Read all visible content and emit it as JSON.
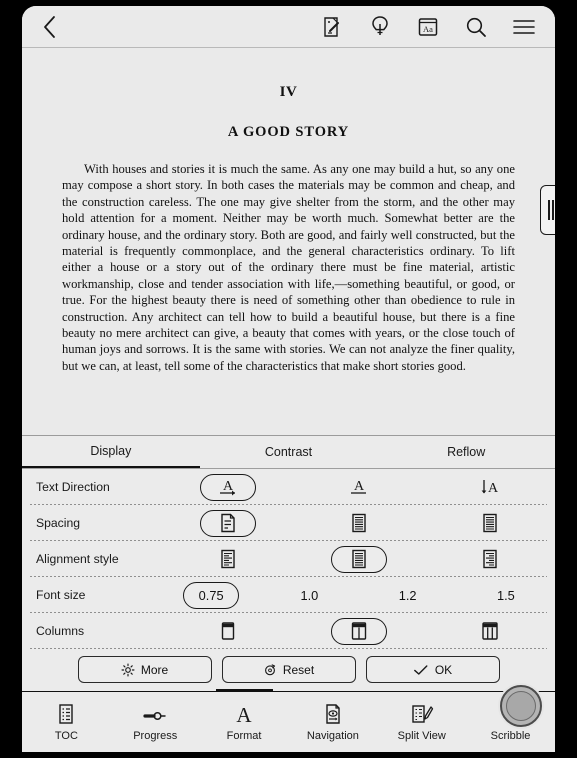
{
  "topbar": {
    "back_icon": "chevron-left-icon",
    "icons": [
      {
        "name": "magic-wand-page-icon",
        "label": "Annotate"
      },
      {
        "name": "lightbulb-icon",
        "label": "Idea"
      },
      {
        "name": "dictionary-aa-icon",
        "label": "Aa"
      },
      {
        "name": "search-icon",
        "label": "Search"
      },
      {
        "name": "hamburger-menu-icon",
        "label": "Menu"
      }
    ]
  },
  "book": {
    "chapter_number": "IV",
    "chapter_title": "A GOOD STORY",
    "body": "With houses and stories it is much the same. As any one may build a hut, so any one may compose a short story. In both cases the materials may be common and cheap, and the construction careless. The one may give shelter from the storm, and the other may hold attention for a moment. Neither may be worth much. Somewhat better are the ordinary house, and the ordinary story. Both are good, and fairly well constructed, but the material is frequently commonplace, and the general characteristics ordinary. To lift either a house or a story out of the ordinary there must be fine material, artistic workmanship, close and tender association with life,—something beautiful, or good, or true. For the highest beauty there is need of something other than obedience to rule in construction. Any architect can tell how to build a beautiful house, but there is a fine beauty no mere architect can give, a beauty that comes with years, or the close touch of human joys and sorrows. It is the same with stories. We can not analyze the finer quality, but we can, at least, tell some of the characteristics that make short stories good."
  },
  "panel": {
    "tabs": [
      {
        "label": "Display",
        "active": true
      },
      {
        "label": "Contrast",
        "active": false
      },
      {
        "label": "Reflow",
        "active": false
      }
    ],
    "rows": [
      {
        "label": "Text Direction",
        "selected_index": 0,
        "options": [
          {
            "icon": "text-direction-ltr-icon"
          },
          {
            "icon": "text-direction-underline-icon"
          },
          {
            "icon": "text-direction-vertical-icon"
          }
        ]
      },
      {
        "label": "Spacing",
        "selected_index": 0,
        "options": [
          {
            "icon": "spacing-loose-icon"
          },
          {
            "icon": "spacing-medium-icon"
          },
          {
            "icon": "spacing-tight-icon"
          }
        ]
      },
      {
        "label": "Alignment style",
        "selected_index": 1,
        "options": [
          {
            "icon": "align-left-icon"
          },
          {
            "icon": "align-justify-icon"
          },
          {
            "icon": "align-right-icon"
          }
        ]
      },
      {
        "label": "Font size",
        "selected_index": 0,
        "options": [
          {
            "value": "0.75"
          },
          {
            "value": "1.0"
          },
          {
            "value": "1.2"
          },
          {
            "value": "1.5"
          }
        ]
      },
      {
        "label": "Columns",
        "selected_index": 1,
        "options": [
          {
            "icon": "one-column-icon"
          },
          {
            "icon": "two-column-icon"
          },
          {
            "icon": "three-column-icon"
          }
        ]
      }
    ],
    "actions": [
      {
        "label": "More",
        "icon": "gear-icon"
      },
      {
        "label": "Reset",
        "icon": "reset-circular-arrow-icon"
      },
      {
        "label": "OK",
        "icon": "checkmark-icon"
      }
    ]
  },
  "bottom_nav": {
    "items": [
      {
        "label": "TOC",
        "icon": "toc-list-icon",
        "active": false
      },
      {
        "label": "Progress",
        "icon": "progress-slider-icon",
        "active": false
      },
      {
        "label": "Format",
        "icon": "format-letter-a-icon",
        "active": true
      },
      {
        "label": "Navigation",
        "icon": "navigation-eye-page-icon",
        "active": false
      },
      {
        "label": "Split View",
        "icon": "split-view-icon",
        "active": false
      },
      {
        "label": "Scribble",
        "icon": "scribble-pen-icon",
        "active": false
      }
    ]
  },
  "floating_button": {
    "name": "assistive-touch-button"
  },
  "side_handle": {
    "name": "side-panel-handle"
  },
  "colors": {
    "screen_bg": "#eaeaea",
    "panel_bg": "#ebebeb",
    "ink": "#111111",
    "bezel": "#000000"
  }
}
